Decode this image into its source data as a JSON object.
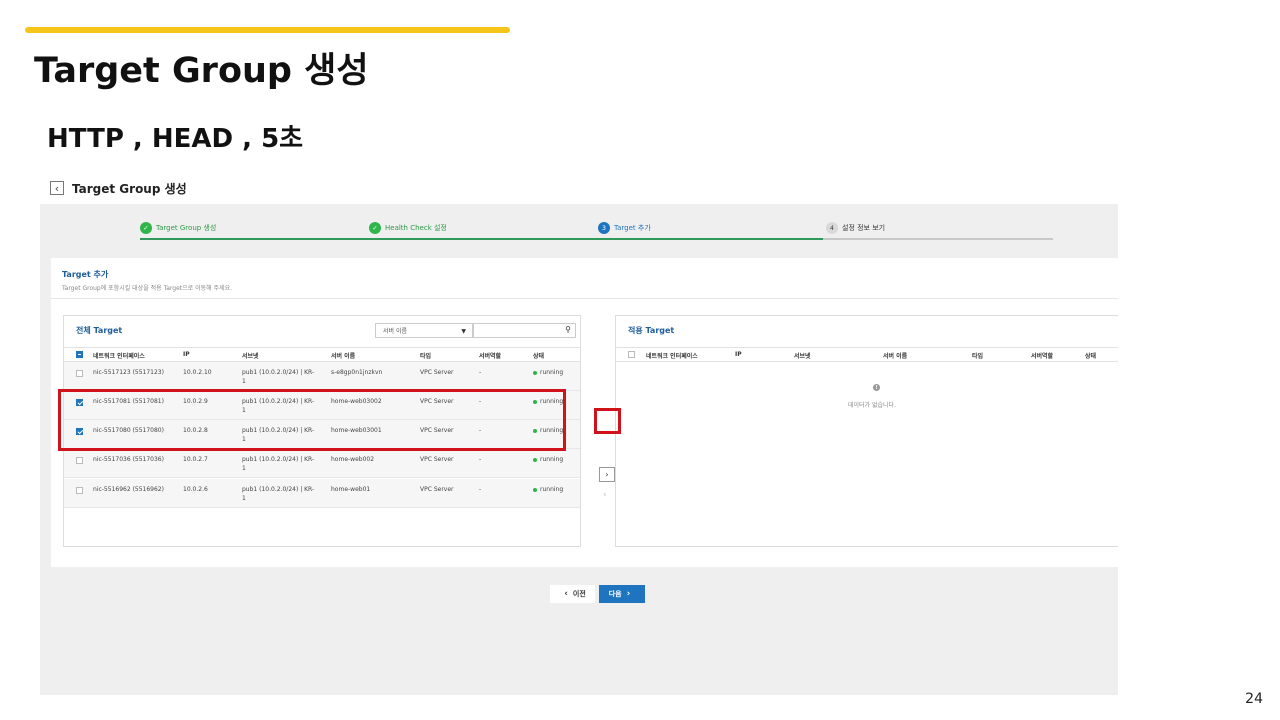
{
  "slide": {
    "title": "Target Group 생성",
    "subtitle": "HTTP , HEAD  , 5초",
    "page_number": "24"
  },
  "console": {
    "page_title": "Target Group 생성",
    "steps": [
      {
        "num": "1",
        "label": "Target Group 생성",
        "state": "done"
      },
      {
        "num": "2",
        "label": "Health Check 설정",
        "state": "done"
      },
      {
        "num": "3",
        "label": "Target 추가",
        "state": "active"
      },
      {
        "num": "4",
        "label": "설정 정보 보기",
        "state": "todo"
      }
    ],
    "panel": {
      "title": "Target 추가",
      "description": "Target Group에 포함시킬 대상을 적용 Target으로 이동해 주세요."
    },
    "left": {
      "title": "전체 Target",
      "search_select": "서버 이름",
      "columns": [
        "네트워크 인터페이스",
        "IP",
        "서브넷",
        "서버 이름",
        "타입",
        "서버역할",
        "상태"
      ],
      "rows": [
        {
          "checked": false,
          "nic": "nic-5517123 (5517123)",
          "ip": "10.0.2.10",
          "subnet_1": "pub1 (10.0.2.0/24) | KR-",
          "subnet_2": "1",
          "server": "s-e8gp0n1jnzkvn",
          "type": "VPC Server",
          "role": "-",
          "status": "running"
        },
        {
          "checked": true,
          "nic": "nic-5517081 (5517081)",
          "ip": "10.0.2.9",
          "subnet_1": "pub1 (10.0.2.0/24) | KR-",
          "subnet_2": "1",
          "server": "home-web03002",
          "type": "VPC Server",
          "role": "-",
          "status": "running"
        },
        {
          "checked": true,
          "nic": "nic-5517080 (5517080)",
          "ip": "10.0.2.8",
          "subnet_1": "pub1 (10.0.2.0/24) | KR-",
          "subnet_2": "1",
          "server": "home-web03001",
          "type": "VPC Server",
          "role": "-",
          "status": "running"
        },
        {
          "checked": false,
          "nic": "nic-5517036 (5517036)",
          "ip": "10.0.2.7",
          "subnet_1": "pub1 (10.0.2.0/24) | KR-",
          "subnet_2": "1",
          "server": "home-web002",
          "type": "VPC Server",
          "role": "-",
          "status": "running"
        },
        {
          "checked": false,
          "nic": "nic-5516962 (5516962)",
          "ip": "10.0.2.6",
          "subnet_1": "pub1 (10.0.2.0/24) | KR-",
          "subnet_2": "1",
          "server": "home-web01",
          "type": "VPC Server",
          "role": "-",
          "status": "running"
        }
      ]
    },
    "right": {
      "title": "적용 Target",
      "columns": [
        "네트워크 인터페이스",
        "IP",
        "서브넷",
        "서버 이름",
        "타입",
        "서버역할",
        "상태"
      ],
      "empty_text": "데이터가 없습니다."
    },
    "buttons": {
      "prev": "이전",
      "next": "다음"
    },
    "icons": {
      "move_right": "chevron-right-icon",
      "move_left": "chevron-left-icon",
      "back": "chevron-left-icon",
      "search": "magnifier-icon"
    },
    "colors": {
      "accent_bar": "#f5c518",
      "highlight": "#d0121b",
      "primary": "#1f74c0",
      "done": "#2fb54a"
    }
  }
}
